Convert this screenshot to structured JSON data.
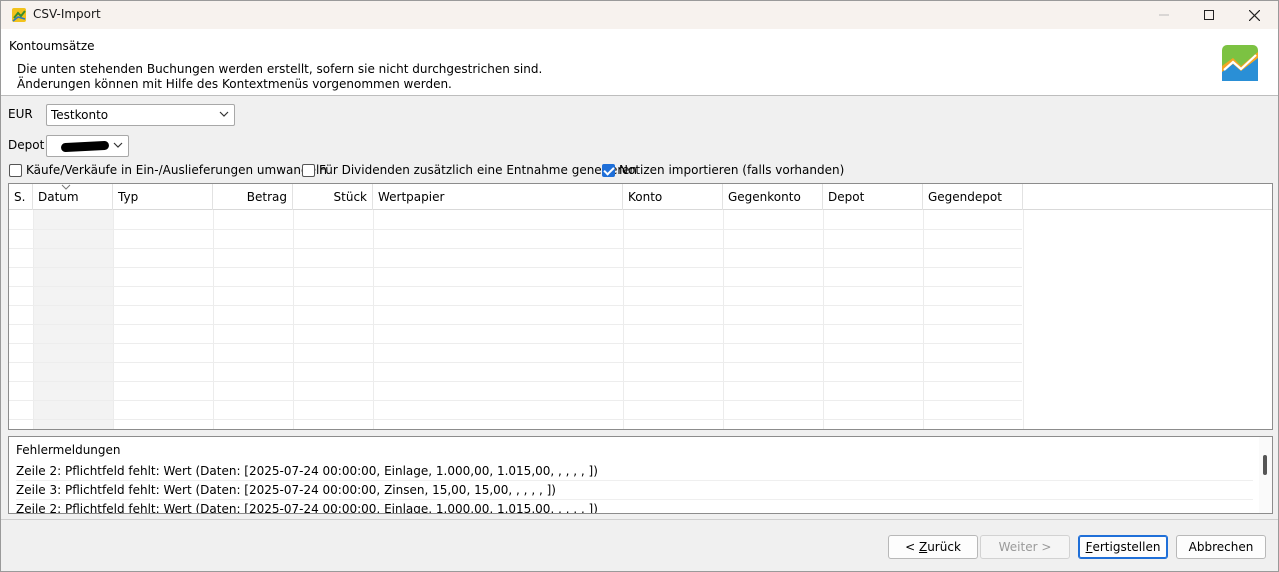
{
  "window": {
    "title": "CSV-Import"
  },
  "header": {
    "title": "Kontoumsätze",
    "description_line1": "Die unten stehenden Buchungen werden erstellt, sofern sie nicht durchgestrichen sind.",
    "description_line2": "Änderungen können mit Hilfe des Kontextmenüs vorgenommen werden."
  },
  "account": {
    "currency_label": "EUR",
    "selected": "Testkonto"
  },
  "depot": {
    "label": "Depot",
    "selected": ""
  },
  "options": [
    {
      "label": "Käufe/Verkäufe in Ein-/Auslieferungen umwandeln",
      "checked": false
    },
    {
      "label": "Für Dividenden zusätzlich eine Entnahme generieren",
      "checked": false
    },
    {
      "label": "Notizen importieren (falls vorhanden)",
      "checked": true
    }
  ],
  "table": {
    "columns": [
      "S.",
      "Datum",
      "Typ",
      "Betrag",
      "Stück",
      "Wertpapier",
      "Konto",
      "Gegenkonto",
      "Depot",
      "Gegendepot"
    ],
    "rows": []
  },
  "errors": {
    "title": "Fehlermeldungen",
    "lines": [
      "Zeile 2: Pflichtfeld fehlt: Wert (Daten: [2025-07-24 00:00:00, Einlage, 1.000,00, 1.015,00, , , , , ])",
      "Zeile 3: Pflichtfeld fehlt: Wert (Daten: [2025-07-24 00:00:00, Zinsen, 15,00, 15,00, , , , , ])",
      "Zeile 2: Pflichtfeld fehlt: Wert (Daten: [2025-07-24 00:00:00, Einlage, 1.000,00, 1.015,00, , , , , ])"
    ]
  },
  "buttons": {
    "back_prefix": "< ",
    "back_mnemonic": "Z",
    "back_rest": "urück",
    "next": "Weiter >",
    "finish_mnemonic": "F",
    "finish_rest": "ertigstellen",
    "cancel": "Abbrechen"
  },
  "colors": {
    "accent": "#1f6fd8",
    "titlebar": "#f7f2ee"
  }
}
